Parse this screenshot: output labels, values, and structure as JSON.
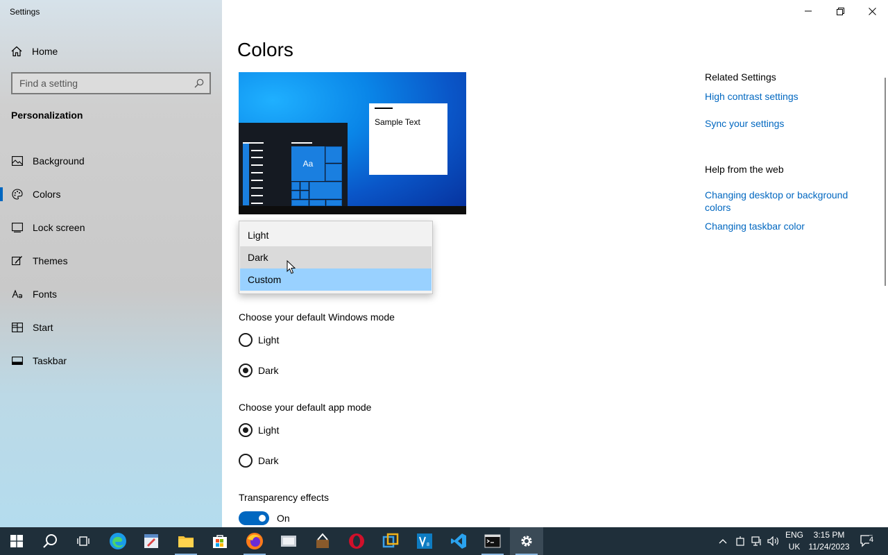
{
  "window": {
    "title": "Settings"
  },
  "sidebar": {
    "home_label": "Home",
    "search_placeholder": "Find a setting",
    "section": "Personalization",
    "items": [
      {
        "label": "Background",
        "icon": "picture-icon"
      },
      {
        "label": "Colors",
        "icon": "palette-icon",
        "selected": true
      },
      {
        "label": "Lock screen",
        "icon": "lock-screen-icon"
      },
      {
        "label": "Themes",
        "icon": "brush-icon"
      },
      {
        "label": "Fonts",
        "icon": "fonts-icon"
      },
      {
        "label": "Start",
        "icon": "start-icon"
      },
      {
        "label": "Taskbar",
        "icon": "taskbar-icon"
      }
    ]
  },
  "main": {
    "title": "Colors",
    "preview": {
      "aa": "Aa",
      "sample_text": "Sample Text"
    },
    "color_dropdown": {
      "options": [
        "Light",
        "Dark",
        "Custom"
      ],
      "hovered": "Dark",
      "selected": "Custom"
    },
    "windows_mode": {
      "label": "Choose your default Windows mode",
      "options": [
        "Light",
        "Dark"
      ],
      "selected": "Dark"
    },
    "app_mode": {
      "label": "Choose your default app mode",
      "options": [
        "Light",
        "Dark"
      ],
      "selected": "Light"
    },
    "transparency": {
      "label": "Transparency effects",
      "state": "On"
    }
  },
  "related": {
    "heading": "Related Settings",
    "links": [
      "High contrast settings",
      "Sync your settings"
    ],
    "help_heading": "Help from the web",
    "help_links": [
      "Changing desktop or background colors",
      "Changing taskbar color"
    ]
  },
  "taskbar": {
    "lang_top": "ENG",
    "lang_bottom": "UK",
    "time": "3:15 PM",
    "date": "11/24/2023",
    "notifications": "4",
    "accent": "#0067c0"
  }
}
